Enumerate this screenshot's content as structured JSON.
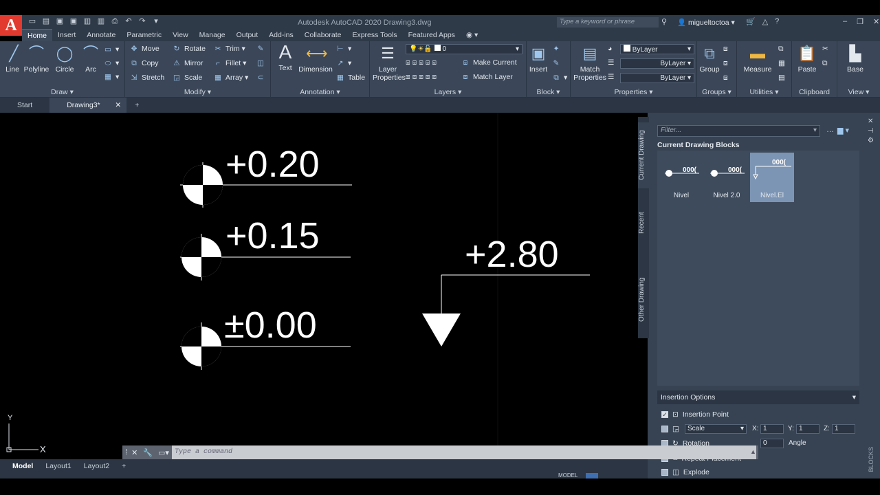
{
  "window": {
    "app_letter": "A",
    "title": "Autodesk AutoCAD 2020    Drawing3.dwg",
    "search_placeholder": "Type a keyword or phrase",
    "user": "migueltoctoa"
  },
  "tabs": [
    "Home",
    "Insert",
    "Annotate",
    "Parametric",
    "View",
    "Manage",
    "Output",
    "Add-ins",
    "Collaborate",
    "Express Tools",
    "Featured Apps"
  ],
  "ribbon": {
    "draw": {
      "title": "Draw",
      "line": "Line",
      "polyline": "Polyline",
      "circle": "Circle",
      "arc": "Arc"
    },
    "modify": {
      "title": "Modify",
      "move": "Move",
      "rotate": "Rotate",
      "trim": "Trim",
      "copy": "Copy",
      "mirror": "Mirror",
      "fillet": "Fillet",
      "stretch": "Stretch",
      "scale": "Scale",
      "array": "Array"
    },
    "annotation": {
      "title": "Annotation",
      "text": "Text",
      "dimension": "Dimension",
      "table": "Table"
    },
    "layers": {
      "title": "Layers",
      "layer_properties": "Layer Properties",
      "current_layer": "0",
      "make_current": "Make Current",
      "match_layer": "Match Layer"
    },
    "block": {
      "title": "Block",
      "insert": "Insert"
    },
    "properties": {
      "title": "Properties",
      "match_properties": "Match Properties",
      "bylayer1": "ByLayer",
      "bylayer2": "ByLayer",
      "bylayer3": "ByLayer"
    },
    "groups": {
      "title": "Groups",
      "group": "Group"
    },
    "utilities": {
      "title": "Utilities",
      "measure": "Measure"
    },
    "clipboard": {
      "title": "Clipboard",
      "paste": "Paste"
    },
    "view": {
      "title": "View",
      "base": "Base"
    }
  },
  "doc_tabs": [
    "Start",
    "Drawing3*"
  ],
  "drawing": {
    "level1": "+0.20",
    "level2": "+0.15",
    "level3": "±0.00",
    "level4": "+2.80",
    "ucs_y": "Y",
    "ucs_x": "X"
  },
  "palette": {
    "vertical_tabs": [
      "Current Drawing",
      "Recent",
      "Other Drawing"
    ],
    "filter_placeholder": "Filter...",
    "section_title": "Current Drawing Blocks",
    "blocks": [
      {
        "name": "Nivel",
        "preview": "000("
      },
      {
        "name": "Nivel 2.0",
        "preview": "000("
      },
      {
        "name": "Nivel.El",
        "preview": "000("
      }
    ],
    "insertion_options": "Insertion Options",
    "insertion_point": "Insertion Point",
    "scale_select": "Scale",
    "x_label": "X:",
    "x_value": "1",
    "y_label": "Y:",
    "y_value": "1",
    "z_label": "Z:",
    "z_value": "1",
    "rotation": "Rotation",
    "rotation_value": "0",
    "angle": "Angle",
    "repeat_placement": "Repeat Placement",
    "explode": "Explode",
    "side_title": "BLOCKS"
  },
  "command": {
    "placeholder": "Type a command"
  },
  "layout_tabs": [
    "Model",
    "Layout1",
    "Layout2"
  ],
  "status": {
    "model": "MODEL"
  }
}
